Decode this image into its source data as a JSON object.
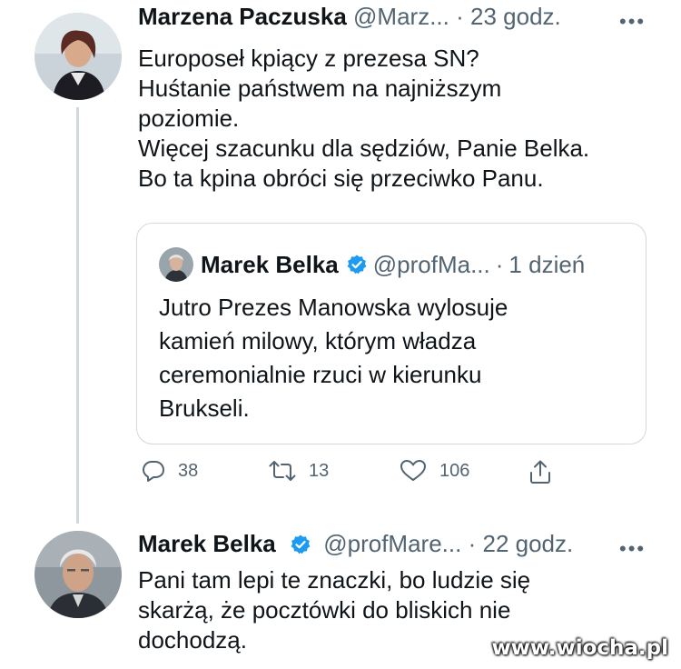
{
  "tweet1": {
    "name": "Marzena Paczuska",
    "handle": "@Marz...",
    "separator": "·",
    "time": "23 godz.",
    "text_lines": [
      "Europoseł kpiący z prezesa SN?",
      "Huśtanie państwem na najniższym",
      "poziomie.",
      "Więcej szacunku dla sędziów, Panie Belka.",
      "Bo ta kpina obróci się przeciwko Panu."
    ],
    "more_icon": "more-dots-icon"
  },
  "quote": {
    "name": "Marek Belka",
    "verified_icon": "verified-badge-icon",
    "handle": "@profMa...",
    "separator": "·",
    "time": "1 dzień",
    "text_lines": [
      "Jutro Prezes Manowska wylosuje",
      "kamień milowy, którym władza",
      "ceremonialnie rzuci w kierunku",
      "Brukseli."
    ]
  },
  "actions": {
    "reply_count": "38",
    "retweet_count": "13",
    "like_count": "106"
  },
  "tweet2": {
    "name": "Marek Belka",
    "verified_icon": "verified-badge-icon",
    "handle": "@profMare...",
    "separator": "·",
    "time": "22 godz.",
    "text_lines": [
      "Pani tam lepi te znaczki, bo ludzie się",
      "skarżą, że pocztówki do bliskich nie",
      "dochodzą."
    ],
    "more_icon": "more-dots-icon"
  },
  "watermark": "www.wiocha.pl",
  "colors": {
    "text": "#0f1419",
    "muted": "#536471",
    "border": "#cfd9de",
    "verified": "#1d9bf0"
  }
}
